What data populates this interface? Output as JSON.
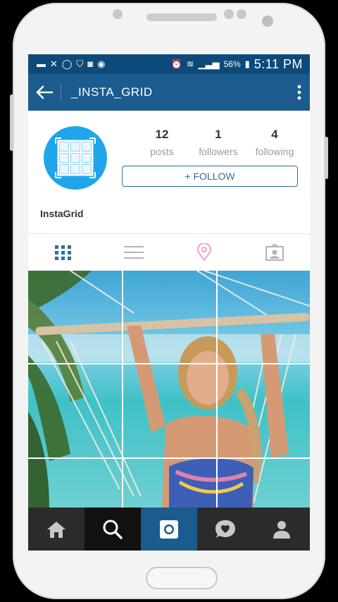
{
  "status_bar": {
    "battery": "56%",
    "time": "5:11 PM",
    "left_icons": [
      "chat-icon",
      "missed-call-icon",
      "whatsapp-icon",
      "shield-icon",
      "camera-icon",
      "app-icon"
    ],
    "right_icons": [
      "alarm-icon",
      "wifi-icon",
      "signal-icon",
      "battery-icon"
    ]
  },
  "app_bar": {
    "title": "_INSTA_GRID",
    "back_icon": "arrow-left-icon",
    "menu_icon": "more-vertical-icon"
  },
  "profile": {
    "posts_count": "12",
    "posts_label": "posts",
    "followers_count": "1",
    "followers_label": "followers",
    "following_count": "4",
    "following_label": "following",
    "follow_button": "+ FOLLOW",
    "username": "InstaGrid"
  },
  "tabs": [
    {
      "name": "grid-view",
      "icon": "grid-icon",
      "active": true
    },
    {
      "name": "list-view",
      "icon": "list-icon",
      "active": false
    },
    {
      "name": "places",
      "icon": "map-pin-icon",
      "active": false
    },
    {
      "name": "tagged",
      "icon": "person-tag-icon",
      "active": false
    }
  ],
  "bottom_nav": [
    {
      "name": "home",
      "icon": "home-icon"
    },
    {
      "name": "search",
      "icon": "search-icon"
    },
    {
      "name": "camera",
      "icon": "camera-icon"
    },
    {
      "name": "activity",
      "icon": "heart-bubble-icon"
    },
    {
      "name": "profile",
      "icon": "person-icon"
    }
  ],
  "colors": {
    "status_bar": "#0d4a7a",
    "app_bar": "#1b5b8e",
    "avatar": "#1ea5ea",
    "follow": "#2e6ea4",
    "nav_bg": "#2b2b2b",
    "nav_active": "#1b5b8e"
  }
}
